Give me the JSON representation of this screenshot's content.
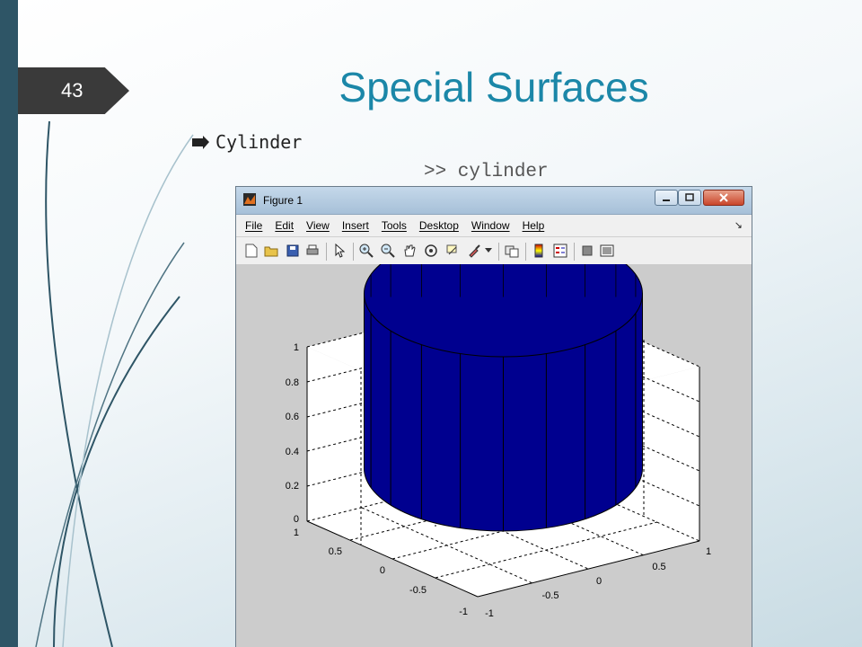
{
  "slide": {
    "number": "43",
    "title": "Special Surfaces",
    "bullet": "Cylinder",
    "command": ">> cylinder"
  },
  "window": {
    "title": "Figure 1",
    "menus": [
      "File",
      "Edit",
      "View",
      "Insert",
      "Tools",
      "Desktop",
      "Window",
      "Help"
    ],
    "toolbar_icons": [
      "new-figure-icon",
      "open-file-icon",
      "save-icon",
      "print-icon",
      "pointer-icon",
      "zoom-in-icon",
      "zoom-out-icon",
      "pan-icon",
      "rotate-3d-icon",
      "data-cursor-icon",
      "brush-icon",
      "link-icon",
      "insert-colorbar-icon",
      "insert-legend-icon",
      "hide-plot-tools-icon",
      "show-plot-tools-icon"
    ]
  },
  "colors": {
    "accent_title": "#1b87a8",
    "cylinder_face": "#00008f",
    "left_bar": "#2e5566"
  },
  "chart_data": {
    "type": "surface",
    "z_ticks": [
      "1",
      "0.8",
      "0.6",
      "0.4",
      "0.2",
      "0"
    ],
    "y_ticks": [
      "1",
      "0.5",
      "0",
      "-0.5",
      "-1"
    ],
    "x_ticks": [
      "-1",
      "-0.5",
      "0",
      "0.5",
      "1"
    ],
    "xlim": [
      -1,
      1
    ],
    "ylim": [
      -1,
      1
    ],
    "zlim": [
      0,
      1
    ],
    "grid": true,
    "radius": 1,
    "height": 1,
    "facets": 20
  }
}
